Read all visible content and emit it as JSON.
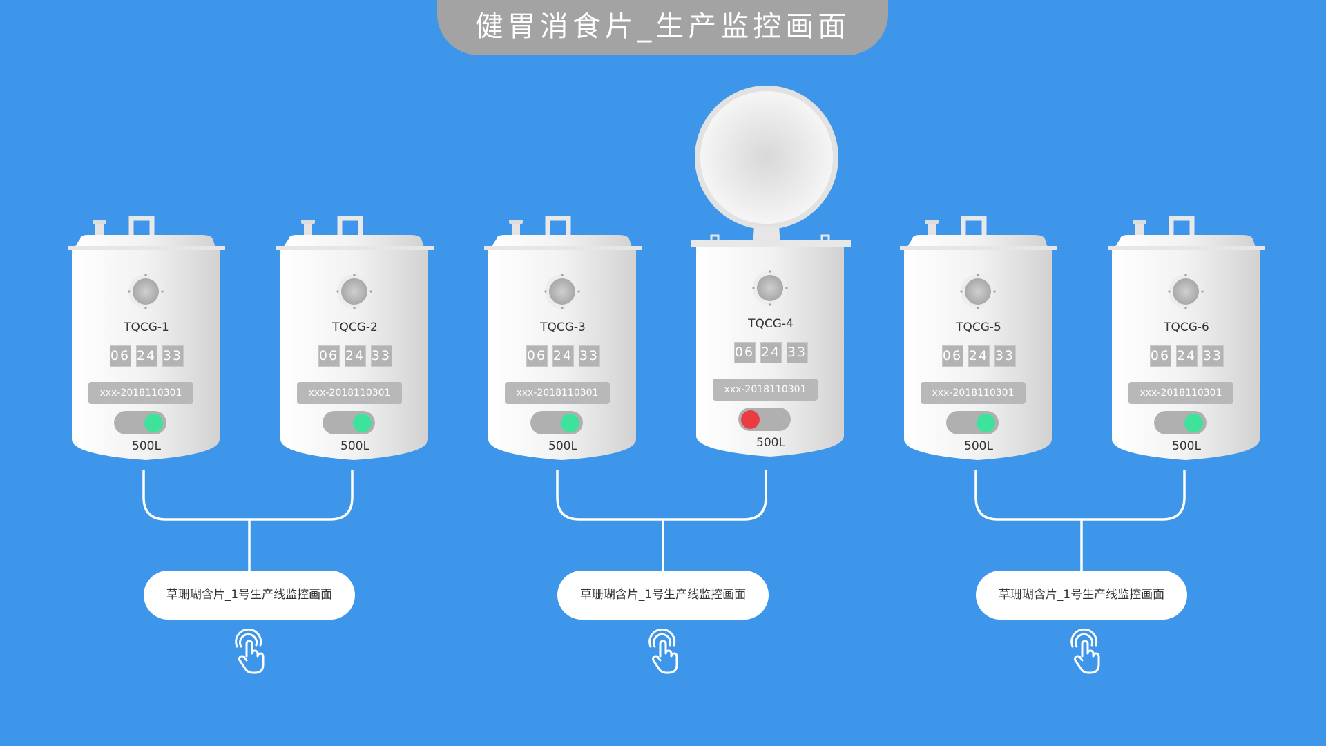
{
  "header": {
    "title": "健胃消食片_生产监控画面"
  },
  "tanks": [
    {
      "name": "TQCG-1",
      "timer": [
        "06",
        "24",
        "33"
      ],
      "batch": "xxx-2018110301",
      "volume": "500L",
      "status": "on"
    },
    {
      "name": "TQCG-2",
      "timer": [
        "06",
        "24",
        "33"
      ],
      "batch": "xxx-2018110301",
      "volume": "500L",
      "status": "on"
    },
    {
      "name": "TQCG-3",
      "timer": [
        "06",
        "24",
        "33"
      ],
      "batch": "xxx-2018110301",
      "volume": "500L",
      "status": "on"
    },
    {
      "name": "TQCG-4",
      "timer": [
        "06",
        "24",
        "33"
      ],
      "batch": "xxx-2018110301",
      "volume": "500L",
      "status": "off",
      "lid": "open"
    },
    {
      "name": "TQCG-5",
      "timer": [
        "06",
        "24",
        "33"
      ],
      "batch": "xxx-2018110301",
      "volume": "500L",
      "status": "on"
    },
    {
      "name": "TQCG-6",
      "timer": [
        "06",
        "24",
        "33"
      ],
      "batch": "xxx-2018110301",
      "volume": "500L",
      "status": "on"
    }
  ],
  "lines": [
    {
      "label": "草珊瑚含片_1号生产线监控画面",
      "icon": "hand-pointer-icon"
    },
    {
      "label": "草珊瑚含片_1号生产线监控画面",
      "icon": "hand-pointer-icon"
    },
    {
      "label": "草珊瑚含片_1号生产线监控画面",
      "icon": "hand-pointer-icon"
    }
  ],
  "colors": {
    "background": "#3d96e9",
    "title_bar": "#a3a3a3",
    "status_on": "#3de39a",
    "status_off": "#ea3d41"
  }
}
